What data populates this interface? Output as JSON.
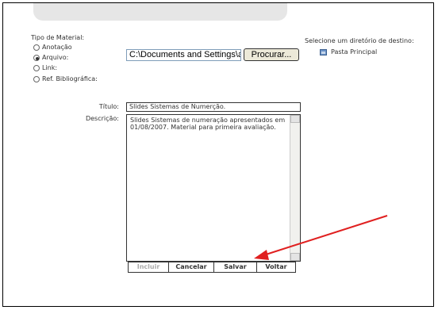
{
  "form": {
    "material_type_label": "Tipo de Material:",
    "options": [
      {
        "label": "Anotação",
        "checked": false
      },
      {
        "label": "Arquivo:",
        "checked": true
      },
      {
        "label": "Link:",
        "checked": false
      },
      {
        "label": "Ref. Bibliográfica:",
        "checked": false
      }
    ],
    "file_path": "C:\\Documents and Settings\\adm",
    "browse_label": "Procurar...",
    "destination_label": "Selecione um diretório de destino:",
    "folder_label": "Pasta Principal",
    "title_label": "Título:",
    "title_value": "Slides Sistemas de Numerção.",
    "description_label": "Descrição:",
    "description_value": "Slides Sistemas de numeração apresentados em 01/08/2007. Material para primeira avaliação."
  },
  "actions": {
    "include": "Incluir",
    "cancel": "Cancelar",
    "save": "Salvar",
    "back": "Voltar"
  },
  "colors": {
    "annotation_arrow": "#e02020"
  }
}
